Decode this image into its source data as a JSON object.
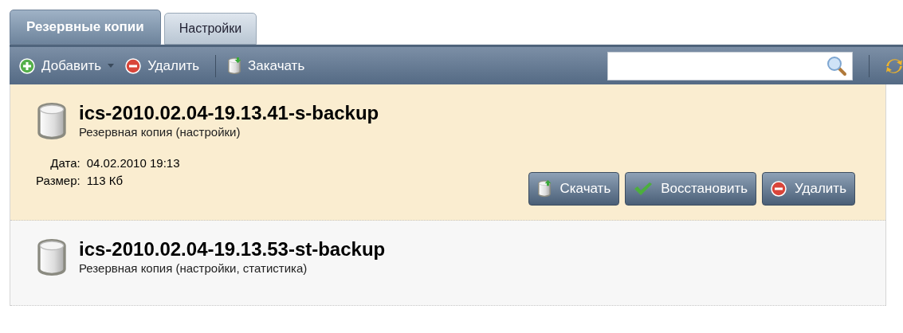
{
  "tabs": [
    {
      "label": "Резервные копии",
      "selected": true
    },
    {
      "label": "Настройки",
      "selected": false
    }
  ],
  "toolbar": {
    "buttons": [
      {
        "kind": "add",
        "label": "Добавить",
        "dropdown": true
      },
      {
        "kind": "delete",
        "label": "Удалить",
        "dropdown": false
      },
      {
        "kind": "upload",
        "label": "Закачать",
        "dropdown": false
      }
    ]
  },
  "backups": [
    {
      "name": "ics-2010.02.04-19.13.41-s-backup",
      "description": "Резервная копия (настройки)",
      "selected": true,
      "details": [
        {
          "label": "Дата:",
          "value": "04.02.2010 19:13"
        },
        {
          "label": "Размер:",
          "value": "113 Кб"
        }
      ],
      "actions": [
        {
          "kind": "download",
          "label": "Скачать"
        },
        {
          "kind": "restore",
          "label": "Восстановить"
        },
        {
          "kind": "delete",
          "label": "Удалить"
        }
      ]
    },
    {
      "name": "ics-2010.02.04-19.13.53-st-backup",
      "description": "Резервная копия (настройки, статистика)",
      "selected": false
    }
  ]
}
